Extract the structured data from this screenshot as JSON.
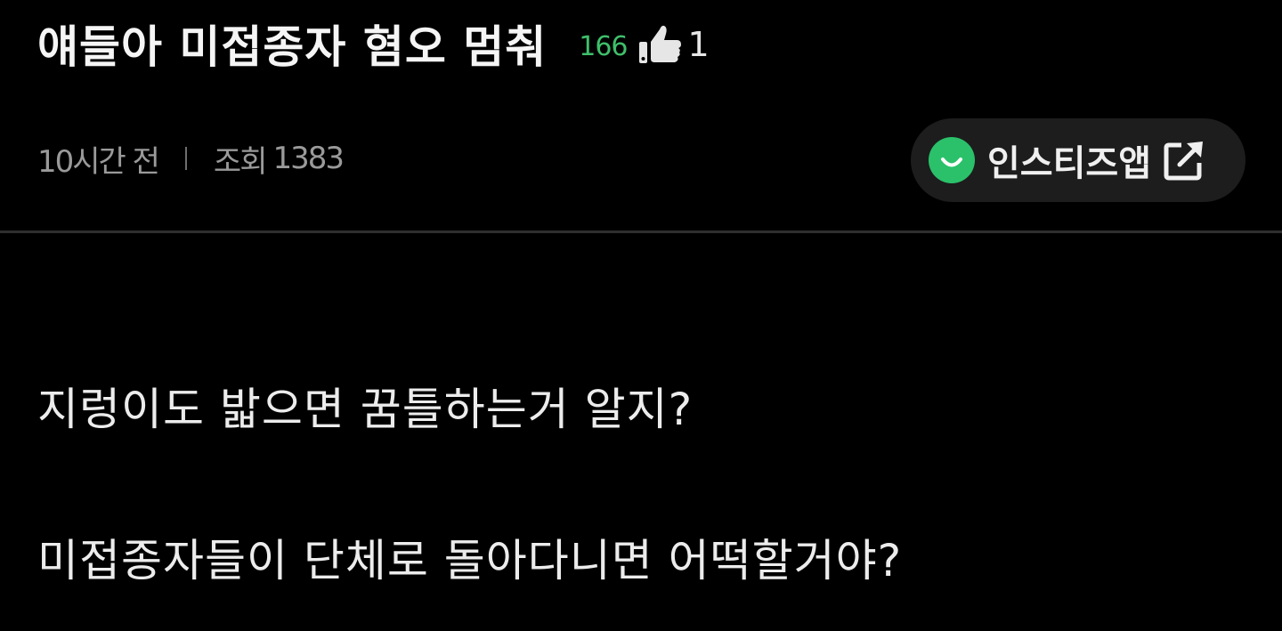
{
  "post": {
    "title": "얘들아 미접종자 혐오 멈춰",
    "comment_count": "166",
    "like_count": "1",
    "time_ago": "10시간 전",
    "views_label": "조회",
    "views_count": "1383"
  },
  "app_link": {
    "label": "인스티즈앱",
    "logo_icon": "instiz-smile-logo-icon",
    "link_icon": "external-link-icon",
    "logo_color": "#2ac16a"
  },
  "content": {
    "lines": [
      "지렁이도 밟으면 꿈틀하는거 알지?",
      "미접종자들이 단체로 돌아다니면 어떡할거야?"
    ]
  },
  "colors": {
    "background": "#000000",
    "comment_count": "#3fbf6b",
    "meta_text": "#9a9a9a",
    "button_bg": "#1d1d1d",
    "divider": "#2e2e2e"
  }
}
